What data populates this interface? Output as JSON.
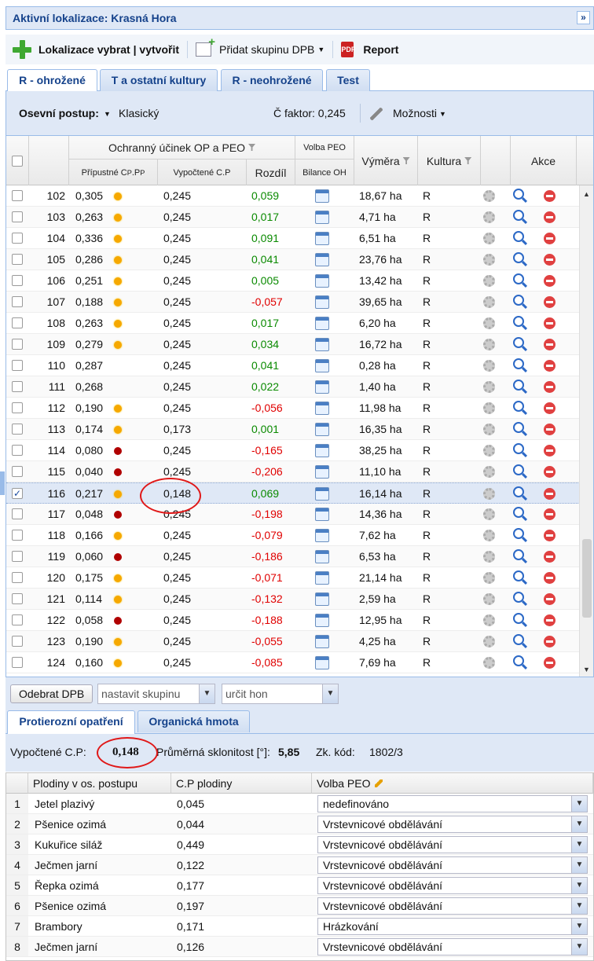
{
  "title": "Aktivní lokalizace: Krasná Hora",
  "collapse_icon": "»",
  "toolbar": {
    "localize_label": "Lokalizace vybrat | vytvořit",
    "add_group_label": "Přidat skupinu DPB",
    "report_label": "Report",
    "pdf_text": "PDF"
  },
  "tabs": [
    "R - ohrožené",
    "T a ostatní kultury",
    "R - neohrožené",
    "Test"
  ],
  "options": {
    "sowing_label": "Osevní postup:",
    "sowing_value": "Klasický",
    "c_factor": "Č faktor: 0,245",
    "options_label": "Možnosti"
  },
  "grid_headers": {
    "group": "Ochranný účinek OP a PEO",
    "allowed": "Přípustné C",
    "allowed_sub1": "P",
    "allowed_mid": ".P",
    "allowed_sub2": "P",
    "computed": "Vypočtené C.P",
    "diff": "Rozdíl",
    "peo_choice": "Volba PEO",
    "balance": "Bilance OH",
    "area": "Výměra",
    "culture": "Kultura",
    "actions": "Akce"
  },
  "rows": [
    {
      "id": "102",
      "allowed": "0,305",
      "dot": "orange",
      "computed": "0,245",
      "diff": "0,059",
      "sign": "pos",
      "area": "18,67 ha",
      "culture": "R"
    },
    {
      "id": "103",
      "allowed": "0,263",
      "dot": "orange",
      "computed": "0,245",
      "diff": "0,017",
      "sign": "pos",
      "area": "4,71 ha",
      "culture": "R"
    },
    {
      "id": "104",
      "allowed": "0,336",
      "dot": "orange",
      "computed": "0,245",
      "diff": "0,091",
      "sign": "pos",
      "area": "6,51 ha",
      "culture": "R"
    },
    {
      "id": "105",
      "allowed": "0,286",
      "dot": "orange",
      "computed": "0,245",
      "diff": "0,041",
      "sign": "pos",
      "area": "23,76 ha",
      "culture": "R"
    },
    {
      "id": "106",
      "allowed": "0,251",
      "dot": "orange",
      "computed": "0,245",
      "diff": "0,005",
      "sign": "pos",
      "area": "13,42 ha",
      "culture": "R"
    },
    {
      "id": "107",
      "allowed": "0,188",
      "dot": "orange",
      "computed": "0,245",
      "diff": "-0,057",
      "sign": "neg",
      "area": "39,65 ha",
      "culture": "R"
    },
    {
      "id": "108",
      "allowed": "0,263",
      "dot": "orange",
      "computed": "0,245",
      "diff": "0,017",
      "sign": "pos",
      "area": "6,20 ha",
      "culture": "R"
    },
    {
      "id": "109",
      "allowed": "0,279",
      "dot": "orange",
      "computed": "0,245",
      "diff": "0,034",
      "sign": "pos",
      "area": "16,72 ha",
      "culture": "R"
    },
    {
      "id": "110",
      "allowed": "0,287",
      "dot": "none",
      "computed": "0,245",
      "diff": "0,041",
      "sign": "pos",
      "area": "0,28 ha",
      "culture": "R"
    },
    {
      "id": "111",
      "allowed": "0,268",
      "dot": "none",
      "computed": "0,245",
      "diff": "0,022",
      "sign": "pos",
      "area": "1,40 ha",
      "culture": "R"
    },
    {
      "id": "112",
      "allowed": "0,190",
      "dot": "orange",
      "computed": "0,245",
      "diff": "-0,056",
      "sign": "neg",
      "area": "11,98 ha",
      "culture": "R"
    },
    {
      "id": "113",
      "allowed": "0,174",
      "dot": "orange",
      "computed": "0,173",
      "diff": "0,001",
      "sign": "pos",
      "area": "16,35 ha",
      "culture": "R"
    },
    {
      "id": "114",
      "allowed": "0,080",
      "dot": "red",
      "computed": "0,245",
      "diff": "-0,165",
      "sign": "neg",
      "area": "38,25 ha",
      "culture": "R"
    },
    {
      "id": "115",
      "allowed": "0,040",
      "dot": "red",
      "computed": "0,245",
      "diff": "-0,206",
      "sign": "neg",
      "area": "11,10 ha",
      "culture": "R"
    },
    {
      "id": "116",
      "allowed": "0,217",
      "dot": "orange",
      "computed": "0,148",
      "diff": "0,069",
      "sign": "pos",
      "area": "16,14 ha",
      "culture": "R",
      "selected": true
    },
    {
      "id": "117",
      "allowed": "0,048",
      "dot": "red",
      "computed": "0,245",
      "diff": "-0,198",
      "sign": "neg",
      "area": "14,36 ha",
      "culture": "R"
    },
    {
      "id": "118",
      "allowed": "0,166",
      "dot": "orange",
      "computed": "0,245",
      "diff": "-0,079",
      "sign": "neg",
      "area": "7,62 ha",
      "culture": "R"
    },
    {
      "id": "119",
      "allowed": "0,060",
      "dot": "red",
      "computed": "0,245",
      "diff": "-0,186",
      "sign": "neg",
      "area": "6,53 ha",
      "culture": "R"
    },
    {
      "id": "120",
      "allowed": "0,175",
      "dot": "orange",
      "computed": "0,245",
      "diff": "-0,071",
      "sign": "neg",
      "area": "21,14 ha",
      "culture": "R"
    },
    {
      "id": "121",
      "allowed": "0,114",
      "dot": "orange",
      "computed": "0,245",
      "diff": "-0,132",
      "sign": "neg",
      "area": "2,59 ha",
      "culture": "R"
    },
    {
      "id": "122",
      "allowed": "0,058",
      "dot": "red",
      "computed": "0,245",
      "diff": "-0,188",
      "sign": "neg",
      "area": "12,95 ha",
      "culture": "R"
    },
    {
      "id": "123",
      "allowed": "0,190",
      "dot": "orange",
      "computed": "0,245",
      "diff": "-0,055",
      "sign": "neg",
      "area": "4,25 ha",
      "culture": "R"
    },
    {
      "id": "124",
      "allowed": "0,160",
      "dot": "orange",
      "computed": "0,245",
      "diff": "-0,085",
      "sign": "neg",
      "area": "7,69 ha",
      "culture": "R"
    }
  ],
  "check_mark": "✓",
  "scroll_up": "▲",
  "scroll_down": "▼",
  "bottombar": {
    "remove_btn": "Odebrat DPB",
    "group_placeholder": "nastavit skupinu",
    "hunt_placeholder": "určit hon",
    "trigger_glyph": "▼"
  },
  "tabs2": [
    "Protierozní opatření",
    "Organická hmota"
  ],
  "info": {
    "computed_label": "Vypočtené C.P:",
    "computed_value": "0,148",
    "slope_label": "Průměrná sklonitost [°]:",
    "slope_value": "5,85",
    "code_label": "Zk. kód:",
    "code_value": "1802/3"
  },
  "crop_headers": {
    "crop": "Plodiny v os. postupu",
    "cp": "C.P plodiny",
    "peo": "Volba PEO"
  },
  "crops": [
    {
      "n": "1",
      "name": "Jetel plazivý",
      "cp": "0,045",
      "peo": "nedefinováno"
    },
    {
      "n": "2",
      "name": "Pšenice ozimá",
      "cp": "0,044",
      "peo": "Vrstevnicové obdělávání"
    },
    {
      "n": "3",
      "name": "Kukuřice siláž",
      "cp": "0,449",
      "peo": "Vrstevnicové obdělávání"
    },
    {
      "n": "4",
      "name": "Ječmen jarní",
      "cp": "0,122",
      "peo": "Vrstevnicové obdělávání"
    },
    {
      "n": "5",
      "name": "Řepka ozimá",
      "cp": "0,177",
      "peo": "Vrstevnicové obdělávání"
    },
    {
      "n": "6",
      "name": "Pšenice ozimá",
      "cp": "0,197",
      "peo": "Vrstevnicové obdělávání"
    },
    {
      "n": "7",
      "name": "Brambory",
      "cp": "0,171",
      "peo": "Hrázkování"
    },
    {
      "n": "8",
      "name": "Ječmen jarní",
      "cp": "0,126",
      "peo": "Vrstevnicové obdělávání"
    }
  ],
  "colors": {
    "header_bg": "#dfe8f6",
    "accent": "#15428b",
    "positive": "#0a8a00",
    "negative": "#e00000"
  }
}
